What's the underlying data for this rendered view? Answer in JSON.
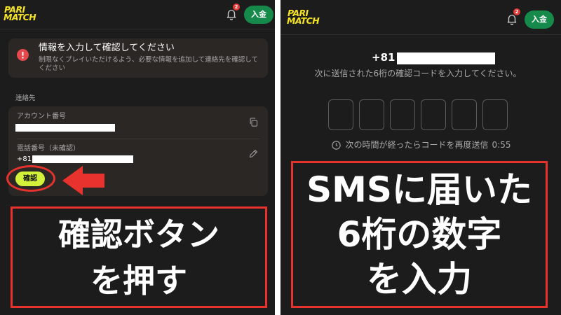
{
  "colors": {
    "panel_bg": "#1c1c1c",
    "card_bg": "#2a2724",
    "brand_yellow": "#f4e225",
    "deposit_green": "#168a4b",
    "confirm_lime": "#d3f03a",
    "alert_red": "#e5484d",
    "badge_red": "#e53935",
    "annotation_red": "#e8322e",
    "text_primary": "#ffffff",
    "text_secondary": "#a9a9a9"
  },
  "icons": {
    "notification": "bell-icon",
    "alert": "exclamation-circle-icon",
    "copy": "copy-icon",
    "edit": "pencil-icon",
    "timer": "clock-icon",
    "pointer": "left-arrow-icon"
  },
  "left_screen": {
    "header": {
      "logo_line1": "PARI",
      "logo_line2": "MATCH",
      "notification_count": "2",
      "deposit_label": "入金"
    },
    "alert": {
      "title": "情報を入力して確認してください",
      "message": "制限なくプレイいただけるよう、必要な情報を追加して連絡先を確認してください"
    },
    "contact": {
      "section_label": "連絡先",
      "account_label": "アカウント番号",
      "phone_label": "電話番号（未確認）",
      "phone_prefix": "+81",
      "confirm_label": "確認"
    }
  },
  "right_screen": {
    "header": {
      "logo_line1": "PARI",
      "logo_line2": "MATCH",
      "notification_count": "2",
      "deposit_label": "入金"
    },
    "phone_prefix": "+81",
    "instruction": "次に送信された6桁の確認コードを入力してください。",
    "code_inputs": [
      "",
      "",
      "",
      "",
      "",
      ""
    ],
    "resend_text": "次の時間が経ったらコードを再度送信",
    "resend_timer": "0:55"
  },
  "annotations": {
    "left_lines": [
      "確認ボタン",
      "を押す"
    ],
    "right_lines": [
      "SMSに届いた",
      "6桁の数字",
      "を入力"
    ]
  }
}
